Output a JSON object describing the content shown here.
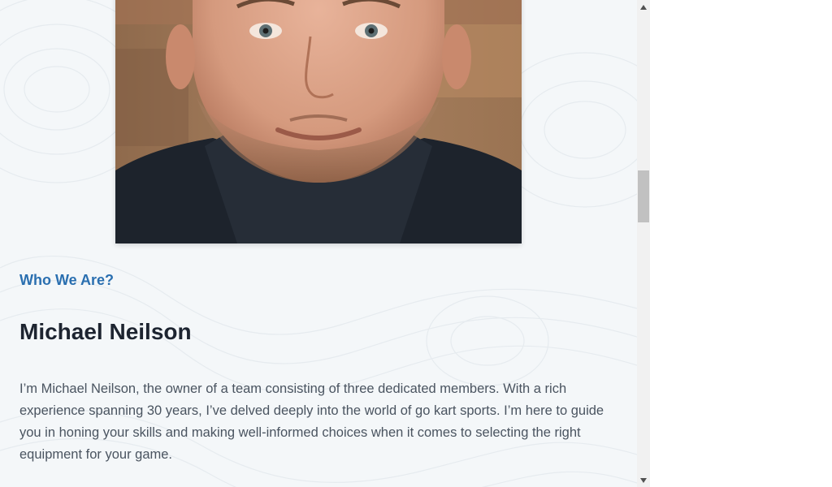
{
  "about": {
    "eyebrow": "Who We Are?",
    "name": "Michael Neilson",
    "bio": "I’m Michael Neilson, the owner of a team consisting of three dedicated members. With a rich experience spanning 30 years, I’ve delved deeply into the world of go kart sports. I’m here to guide you in honing your skills and making well-informed choices when it comes to selecting the right equipment for your game."
  },
  "colors": {
    "accent": "#2a6fb0",
    "heading": "#1d2430",
    "body_text": "#4a5460",
    "page_bg": "#f4f7f9"
  },
  "icons": {
    "scroll_up": "triangle-up-icon",
    "scroll_down": "triangle-down-icon"
  }
}
